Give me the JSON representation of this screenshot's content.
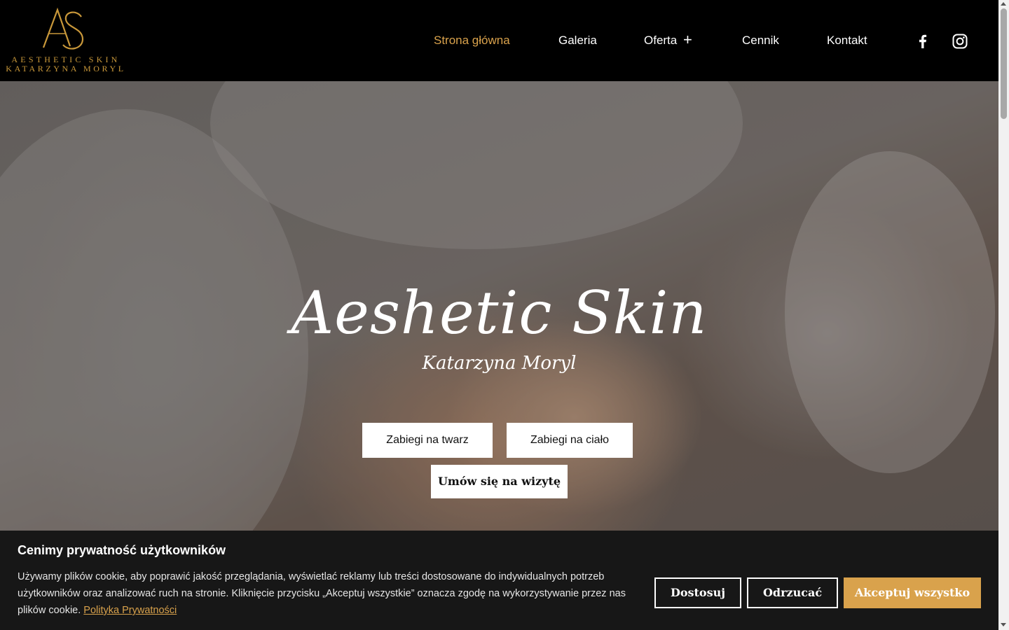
{
  "brand": {
    "logo_line1": "AESTHETIC SKIN",
    "logo_line2": "KATARZYNA MORYL",
    "accent_color": "#c9983a"
  },
  "nav": {
    "items": [
      {
        "label": "Strona główna",
        "active": true
      },
      {
        "label": "Galeria"
      },
      {
        "label": "Oferta",
        "has_submenu": true
      },
      {
        "label": "Cennik"
      },
      {
        "label": "Kontakt"
      }
    ],
    "submenu_icon": "plus-icon",
    "social": [
      "facebook-icon",
      "instagram-icon"
    ]
  },
  "hero": {
    "title": "Aeshetic Skin",
    "subtitle": "Katarzyna Moryl",
    "buttons": {
      "face": "Zabiegi na twarz",
      "body": "Zabiegi na ciało",
      "book": "Umów się na wizytę"
    }
  },
  "cookie": {
    "title": "Cenimy prywatność użytkowników",
    "text": "Używamy plików cookie, aby poprawić jakość przeglądania, wyświetlać reklamy lub treści dostosowane do indywidualnych potrzeb użytkowników oraz analizować ruch na stronie. Kliknięcie przycisku „Akceptuj wszystkie” oznacza zgodę na wykorzystywanie przez nas plików cookie.",
    "policy_link": "Polityka Prywatności",
    "buttons": {
      "customize": "Dostosuj",
      "reject": "Odrzucać",
      "accept": "Akceptuj wszystko"
    }
  }
}
